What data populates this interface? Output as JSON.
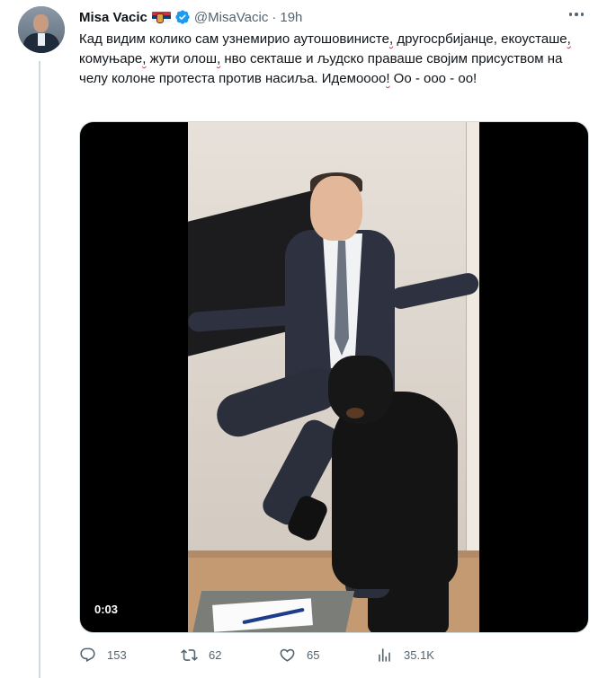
{
  "tweet": {
    "author": {
      "name": "Misa Vacic",
      "handle": "@MisaVacic",
      "verified": true,
      "flag_icon": "serbia-flag-icon"
    },
    "separator": "·",
    "time": "19h",
    "text_parts": [
      {
        "text": "Кад видим колико сам узнемирио аутошовинисте",
        "sq": false
      },
      {
        "text": "",
        "sq": true,
        "marked": ","
      },
      {
        "text": " другосрбијанце, екоусташе",
        "sq": false
      },
      {
        "text": "",
        "sq": true,
        "marked": ","
      },
      {
        "text": " комуњаре",
        "sq": false
      },
      {
        "text": "",
        "sq": true,
        "marked": ","
      },
      {
        "text": " жути олош",
        "sq": false
      },
      {
        "text": "",
        "sq": true,
        "marked": ","
      },
      {
        "text": " нво секташе и људско праваше својим присуством на челу колоне протеста против насиља. Идемоооо",
        "sq": false
      },
      {
        "text": "",
        "sq": true,
        "marked": "!"
      },
      {
        "text": " Оо - ооо - оо!",
        "sq": false
      }
    ],
    "media": {
      "type": "video",
      "duration": "0:03"
    }
  },
  "actions": {
    "reply": {
      "icon": "reply-icon",
      "count": "153"
    },
    "retweet": {
      "icon": "retweet-icon",
      "count": "62"
    },
    "like": {
      "icon": "heart-icon",
      "count": "65"
    },
    "views": {
      "icon": "views-icon",
      "count": "35.1K"
    },
    "bookmark": {
      "icon": "bookmark-icon"
    },
    "share": {
      "icon": "share-icon"
    }
  },
  "colors": {
    "text": "#0f1419",
    "secondary": "#536471",
    "verified": "#1d9bf0",
    "border": "#cfd9de",
    "spellcheck": "#e0245e"
  }
}
